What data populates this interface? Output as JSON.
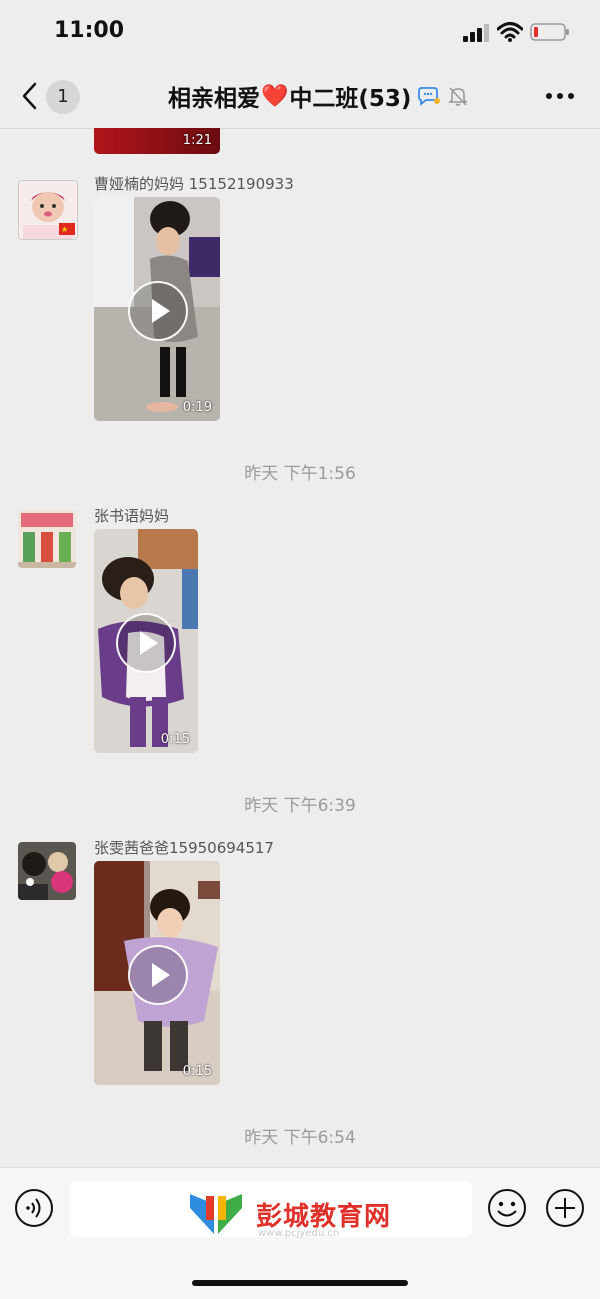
{
  "status_bar": {
    "time": "11:00"
  },
  "header": {
    "back_count": "1",
    "title_left": "相亲相爱",
    "title_heart": "❤️",
    "title_right": "中二班(53)"
  },
  "messages": [
    {
      "duration": "1:21"
    },
    {
      "sender": "曹娅楠的妈妈 15152190933",
      "duration": "0:19"
    },
    {
      "timestamp": "昨天 下午1:56"
    },
    {
      "sender": "张书语妈妈",
      "duration": "0:15"
    },
    {
      "timestamp": "昨天 下午6:39"
    },
    {
      "sender": "张雯茜爸爸15950694517",
      "duration": "0:15"
    },
    {
      "timestamp": "昨天 下午6:54"
    }
  ],
  "watermark": {
    "text": "彭城教育网",
    "subtext": "www.pcjyedu.cn"
  },
  "colors": {
    "background": "#ededed",
    "heart": "#e0322b",
    "watermark": "#e0302a"
  }
}
